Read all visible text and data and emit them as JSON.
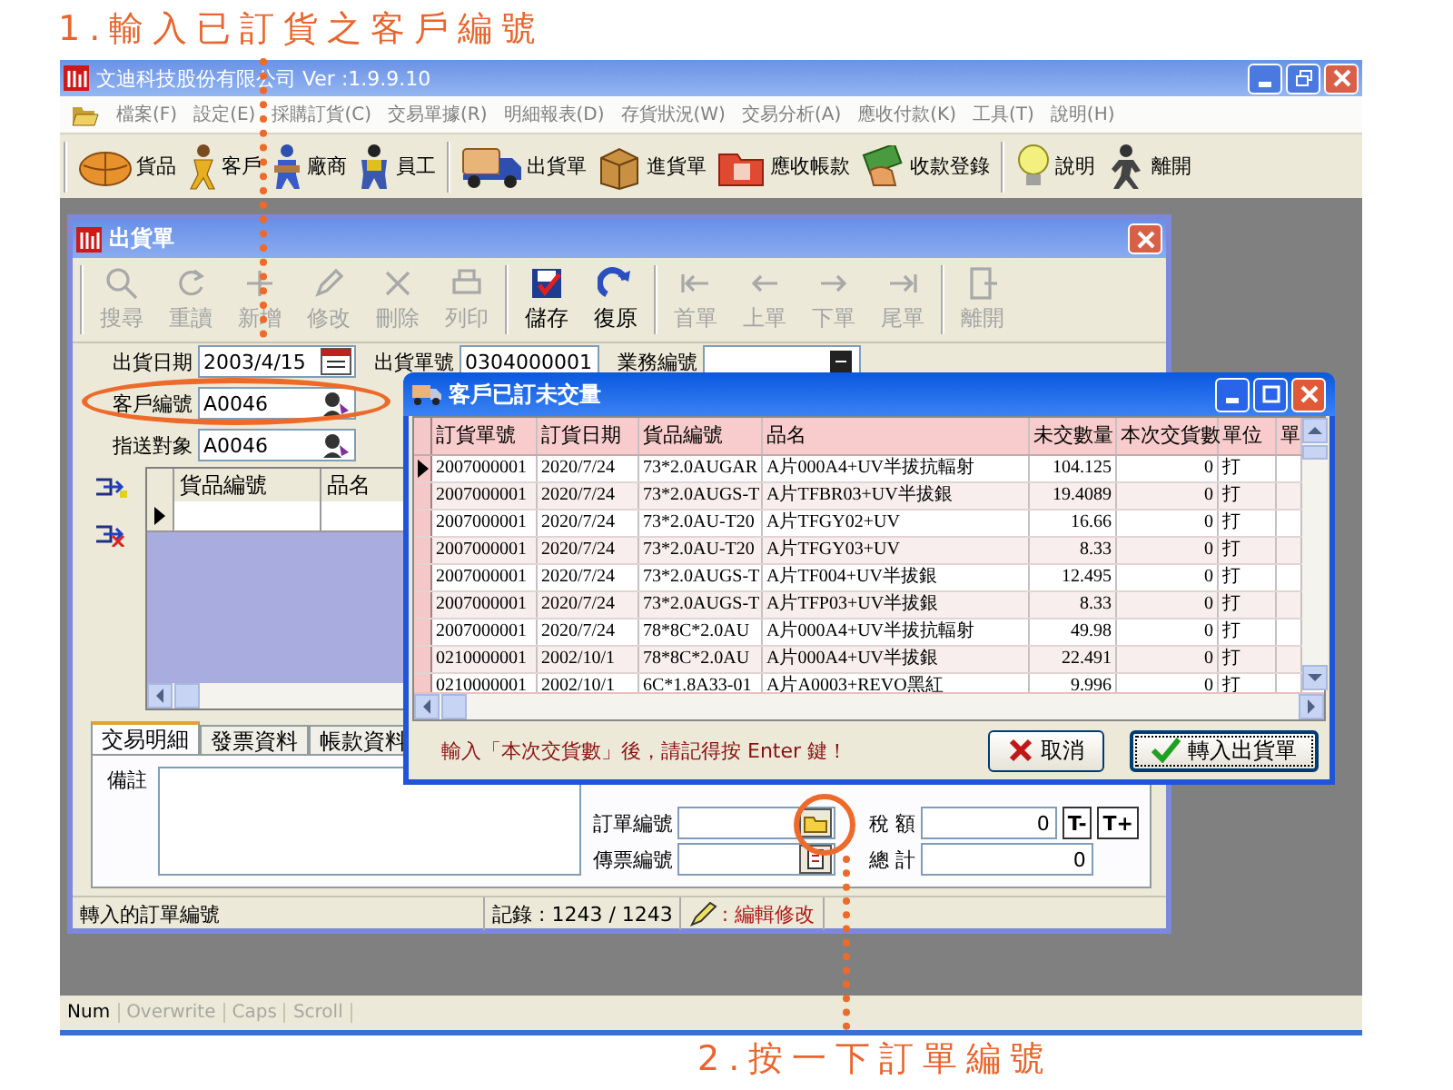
{
  "steps": [
    "1.輸入已訂貨之客戶編號",
    "2.按一下訂單編號"
  ],
  "app": {
    "title": "文迪科技股份有限公司  Ver :1.9.9.10",
    "menu": [
      "檔案(F)",
      "設定(E)",
      "採購訂貨(C)",
      "交易單據(R)",
      "明細報表(D)",
      "存貨狀況(W)",
      "交易分析(A)",
      "應收付款(K)",
      "工具(T)",
      "說明(H)"
    ],
    "toolbar": [
      [
        {
          "label": "貨品",
          "kind": "bundle"
        },
        {
          "label": "客戶",
          "kind": "customer"
        },
        {
          "label": "廠商",
          "kind": "vendor"
        },
        {
          "label": "員工",
          "kind": "staff"
        }
      ],
      [
        {
          "label": "出貨單",
          "kind": "truck"
        },
        {
          "label": "進貨單",
          "kind": "box"
        },
        {
          "label": "應收帳款",
          "kind": "ledger"
        },
        {
          "label": "收款登錄",
          "kind": "money"
        }
      ],
      [
        {
          "label": "說明",
          "kind": "help"
        },
        {
          "label": "離開",
          "kind": "exit"
        }
      ]
    ],
    "status_bar": [
      {
        "label": "Num",
        "on": true
      },
      {
        "label": "Overwrite",
        "on": false
      },
      {
        "label": "Caps",
        "on": false
      },
      {
        "label": "Scroll",
        "on": false
      }
    ]
  },
  "shipment": {
    "title": "出貨單",
    "toolbar": [
      [
        {
          "label": "搜尋",
          "kind": "search",
          "disabled": true
        },
        {
          "label": "重讀",
          "kind": "refresh",
          "disabled": true
        },
        {
          "label": "新增",
          "kind": "add",
          "disabled": true
        },
        {
          "label": "修改",
          "kind": "edit",
          "disabled": true
        },
        {
          "label": "刪除",
          "kind": "delete",
          "disabled": true
        },
        {
          "label": "列印",
          "kind": "print",
          "disabled": true
        }
      ],
      [
        {
          "label": "儲存",
          "kind": "save",
          "disabled": false
        },
        {
          "label": "復原",
          "kind": "undo",
          "disabled": false
        }
      ],
      [
        {
          "label": "首單",
          "kind": "first",
          "disabled": true
        },
        {
          "label": "上單",
          "kind": "prev",
          "disabled": true
        },
        {
          "label": "下單",
          "kind": "next",
          "disabled": true
        },
        {
          "label": "尾單",
          "kind": "last",
          "disabled": true
        }
      ],
      [
        {
          "label": "離開",
          "kind": "close",
          "disabled": true
        }
      ]
    ],
    "header_fields": [
      [
        {
          "label": "出貨日期",
          "value": "2003/4/15",
          "kind": "calendar"
        },
        {
          "label": "出貨單號",
          "value": "0304000001",
          "kind": "plain"
        },
        {
          "label": "業務編號",
          "kind": "lookup"
        }
      ],
      [
        {
          "label": "客戶編號",
          "value": "A0046",
          "kind": "customer"
        }
      ],
      [
        {
          "label": "指送對象",
          "value": "A0046",
          "kind": "customer"
        }
      ]
    ],
    "grid": {
      "columns": [
        "貨品編號",
        "品名"
      ],
      "new_row": {
        "current": true
      }
    },
    "tabs": [
      {
        "label": "交易明細",
        "selected": true
      },
      {
        "label": "發票資料",
        "selected": false
      },
      {
        "label": "帳款資料",
        "selected": false
      }
    ],
    "memo_label": "備註",
    "totals": [
      [
        {
          "label": "訂單編號",
          "kind": "folder"
        },
        {
          "label": "稅 額",
          "value": "0",
          "kind": "plain",
          "adjust": [
            "T-",
            "T+"
          ]
        }
      ],
      [
        {
          "label": "傳票編號",
          "kind": "voucher"
        },
        {
          "label": "總 計",
          "value": "0",
          "kind": "plain"
        }
      ]
    ],
    "status": [
      {
        "text": "轉入的訂單編號",
        "kind": "plain"
      },
      {
        "text": "記錄 : 1243 / 1243",
        "kind": "plain"
      },
      {
        "text": ": 編輯修改",
        "kind": "mode"
      }
    ]
  },
  "dialog": {
    "title": "客戶已訂未交量",
    "columns": [
      "訂貨單號",
      "訂貨日期",
      "貨品編號",
      "品名",
      "未交數量",
      "本次交貨數",
      "單位",
      "單"
    ],
    "rows": [
      {
        "current": true,
        "cells": [
          "2007000001",
          "2020/7/24",
          "73*2.0AUGAR",
          "A片000A4+UV半拔抗輻射",
          "104.125",
          "0",
          "打"
        ]
      },
      {
        "current": false,
        "cells": [
          "2007000001",
          "2020/7/24",
          "73*2.0AUGS-T",
          "A片TFBR03+UV半拔銀",
          "19.4089",
          "0",
          "打"
        ]
      },
      {
        "current": false,
        "cells": [
          "2007000001",
          "2020/7/24",
          "73*2.0AU-T20",
          "A片TFGY02+UV",
          "16.66",
          "0",
          "打"
        ]
      },
      {
        "current": false,
        "cells": [
          "2007000001",
          "2020/7/24",
          "73*2.0AU-T20",
          "A片TFGY03+UV",
          "8.33",
          "0",
          "打"
        ]
      },
      {
        "current": false,
        "cells": [
          "2007000001",
          "2020/7/24",
          "73*2.0AUGS-T",
          "A片TF004+UV半拔銀",
          "12.495",
          "0",
          "打"
        ]
      },
      {
        "current": false,
        "cells": [
          "2007000001",
          "2020/7/24",
          "73*2.0AUGS-T",
          "A片TFP03+UV半拔銀",
          "8.33",
          "0",
          "打"
        ]
      },
      {
        "current": false,
        "cells": [
          "2007000001",
          "2020/7/24",
          "78*8C*2.0AU",
          "A片000A4+UV半拔抗輻射",
          "49.98",
          "0",
          "打"
        ]
      },
      {
        "current": false,
        "cells": [
          "0210000001",
          "2002/10/1",
          "78*8C*2.0AU",
          "A片000A4+UV半拔銀",
          "22.491",
          "0",
          "打"
        ]
      },
      {
        "current": false,
        "cells": [
          "0210000001",
          "2002/10/1",
          "6C*1.8A33-01",
          "A片A0003+REVO黑紅",
          "9.996",
          "0",
          "打"
        ]
      }
    ],
    "message": "輸入「本次交貨數」後，請記得按 Enter 鍵！",
    "buttons": [
      {
        "label": "取消",
        "kind": "cancel",
        "default": false
      },
      {
        "label": "轉入出貨單",
        "kind": "confirm",
        "default": true
      }
    ]
  }
}
